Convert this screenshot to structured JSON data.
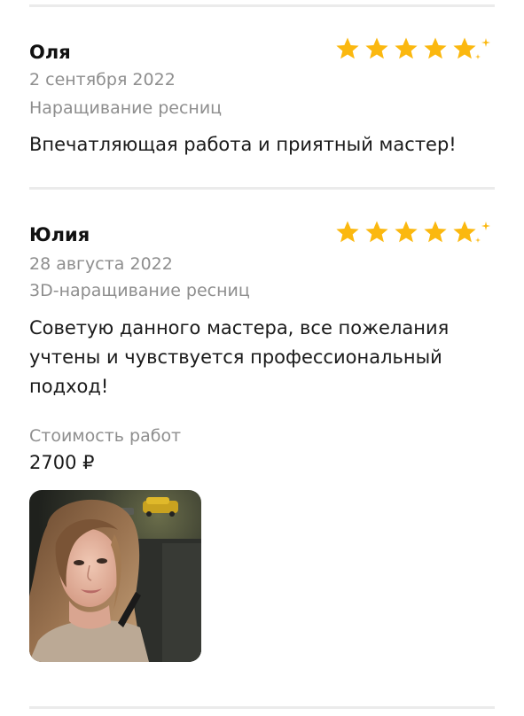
{
  "reviews": [
    {
      "name": "Оля",
      "date": "2 сентября 2022",
      "service": "Наращивание ресниц",
      "text": "Впечатляющая работа и приятный мастер!",
      "rating": 5
    },
    {
      "name": "Юлия",
      "date": "28 августа 2022",
      "service": "3D-наращивание ресниц",
      "text": "Советую данного мастера, все пожелания учтены и чувствуется профессиональный подход!",
      "rating": 5,
      "cost_label": "Стоимость работ",
      "cost_value": "2700 ₽"
    }
  ],
  "colors": {
    "star": "#fbb80f",
    "muted_text": "#8e8e8e",
    "divider": "#ebebeb"
  },
  "icons": {
    "star": "star-icon",
    "sparkle": "sparkle-icon"
  }
}
